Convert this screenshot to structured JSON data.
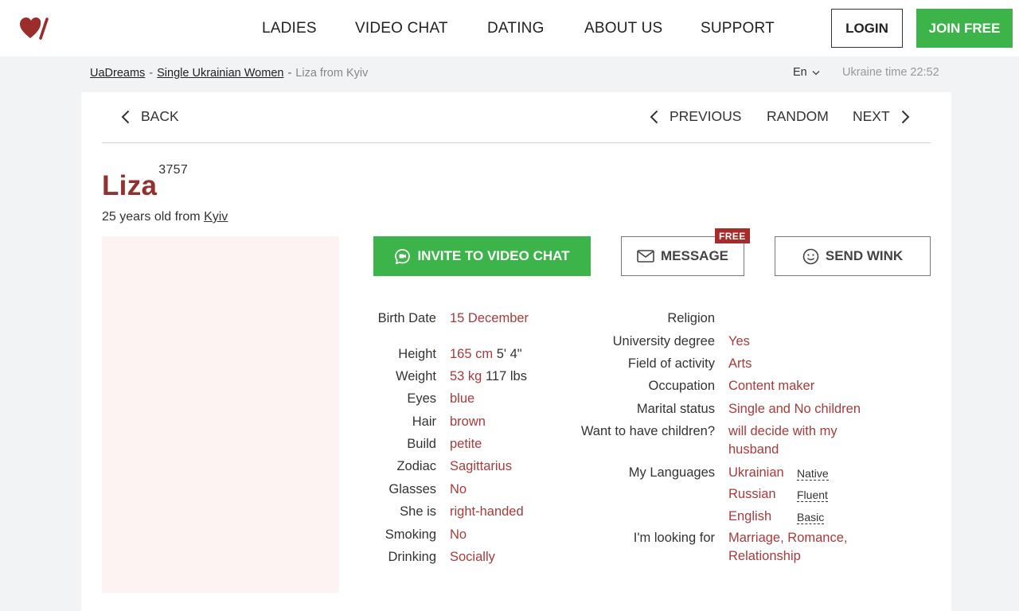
{
  "header": {
    "nav": [
      "LADIES",
      "VIDEO CHAT",
      "DATING",
      "ABOUT US",
      "SUPPORT"
    ],
    "login_label": "LOGIN",
    "join_label": "JOIN FREE"
  },
  "breadcrumb": {
    "home": "UaDreams",
    "section": "Single Ukrainian Women",
    "current": "Liza from Kyiv",
    "separator": "-"
  },
  "language": "En",
  "ukraine_time": "Ukraine time 22:52",
  "profile_nav": {
    "back": "BACK",
    "previous": "PREVIOUS",
    "random": "RANDOM",
    "next": "NEXT"
  },
  "profile": {
    "name": "Liza",
    "id": "3757",
    "age_text": "25 years old from",
    "city": "Kyiv"
  },
  "actions": {
    "invite": "INVITE TO VIDEO CHAT",
    "message": "MESSAGE",
    "free_badge": "FREE",
    "wink": "SEND WINK"
  },
  "details_left": [
    {
      "label": "Birth Date",
      "value": "15 December",
      "extra": ""
    },
    {
      "label": "Height",
      "value": "165 cm",
      "extra": "5' 4\""
    },
    {
      "label": "Weight",
      "value": "53 kg",
      "extra": "117 lbs"
    },
    {
      "label": "Eyes",
      "value": "blue",
      "extra": ""
    },
    {
      "label": "Hair",
      "value": "brown",
      "extra": ""
    },
    {
      "label": "Build",
      "value": "petite",
      "extra": ""
    },
    {
      "label": "Zodiac",
      "value": "Sagittarius",
      "extra": ""
    },
    {
      "label": "Glasses",
      "value": "No",
      "extra": ""
    },
    {
      "label": "She is",
      "value": "right-handed",
      "extra": ""
    },
    {
      "label": "Smoking",
      "value": "No",
      "extra": ""
    },
    {
      "label": "Drinking",
      "value": "Socially",
      "extra": ""
    }
  ],
  "details_right": {
    "religion_label": "Religion",
    "degree_label": "University degree",
    "degree": "Yes",
    "field_label": "Field of activity",
    "field": "Arts",
    "occupation_label": "Occupation",
    "occupation": "Content maker",
    "marital_label": "Marital status",
    "marital": "Single and No children",
    "children_label": "Want to have children?",
    "children_line1": "will decide with my",
    "children_line2": "husband",
    "languages_label": "My Languages",
    "languages": [
      {
        "name": "Ukrainian",
        "level": "Native"
      },
      {
        "name": "Russian",
        "level": "Fluent"
      },
      {
        "name": "English",
        "level": "Basic"
      }
    ],
    "looking_label": "I'm looking for",
    "looking_line1": "Marriage, Romance,",
    "looking_line2": "Relationship"
  },
  "colors": {
    "accent_green": "#3cb44a",
    "accent_red": "#943030",
    "value_red": "#a83b3b"
  }
}
